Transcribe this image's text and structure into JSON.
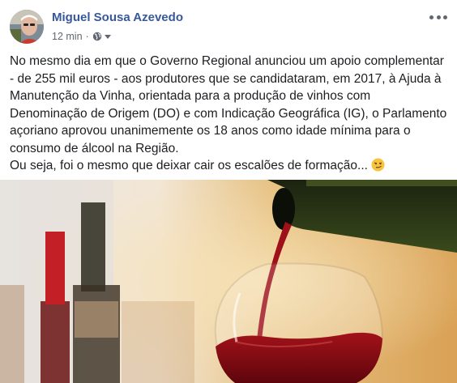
{
  "post": {
    "author": "Miguel Sousa Azevedo",
    "timestamp": "12 min",
    "separator": "·",
    "privacy_icon": "globe-icon",
    "privacy_menu_icon": "chevron-down-icon",
    "more_icon": "more-options-icon",
    "lines": [
      "No mesmo dia em que o Governo Regional anunciou um apoio complementar",
      "- de 255 mil euros - aos produtores que se candidataram, em 2017, à Ajuda à",
      "Manutenção da Vinha, orientada para a produção de vinhos com",
      "Denominação de Origem (DO) e com Indicação Geográfica (IG), o Parlamento",
      "açoriano aprovou unanimemente os 18 anos como idade mínima para o",
      "consumo de álcool na Região.",
      "Ou seja, foi o mesmo que deixar cair os escalões de formação..."
    ],
    "emoji": "smirking-face-emoji",
    "image": "wine-pouring-photo"
  },
  "colors": {
    "author": "#385898",
    "meta": "#606770",
    "text": "#1c1e21",
    "wine": "#8b0a12"
  }
}
